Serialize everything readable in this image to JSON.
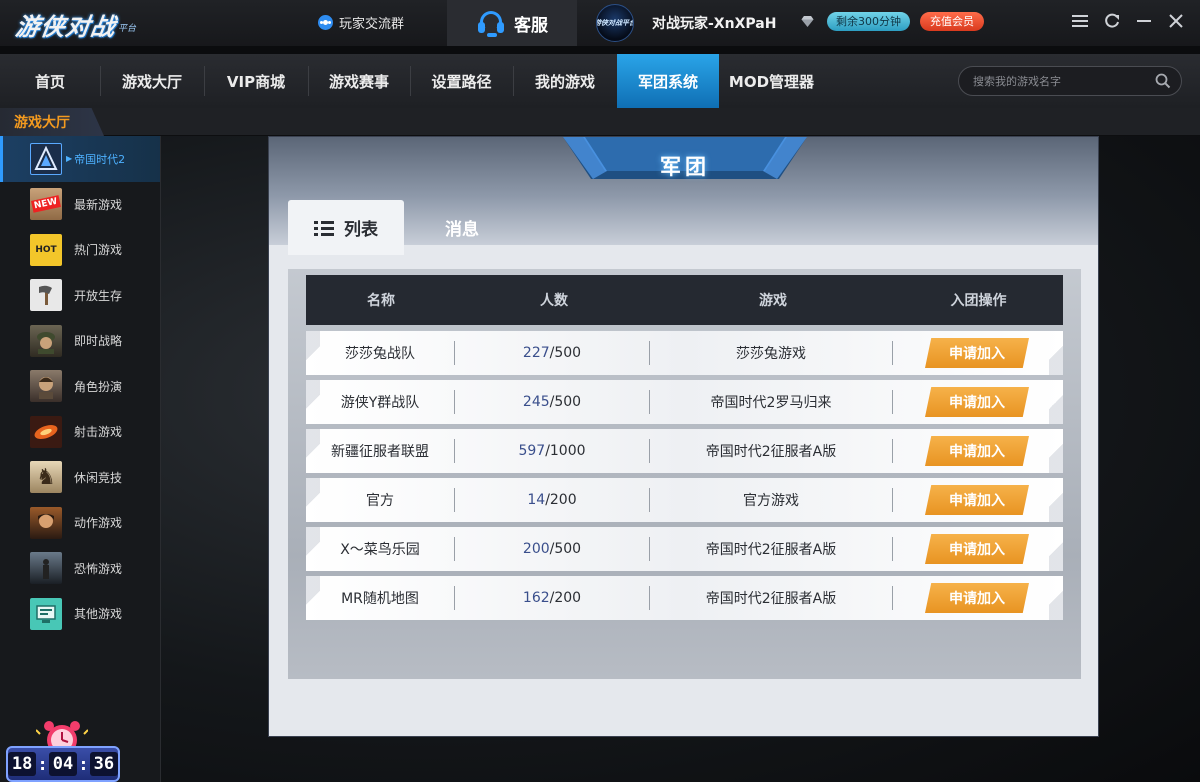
{
  "titlebar": {
    "logo_main": "游侠对战",
    "logo_sub": "平台",
    "group_link": "玩家交流群",
    "service": "客服",
    "avatar_text": "游侠对战平台",
    "username": "对战玩家-XnXPaH",
    "time_badge": "剩余300分钟",
    "vip_badge": "充值会员"
  },
  "nav": {
    "items": [
      "首页",
      "游戏大厅",
      "VIP商城",
      "游戏赛事",
      "设置路径",
      "我的游戏",
      "军团系统",
      "MOD管理器"
    ],
    "active_index": 6,
    "search_placeholder": "搜索我的游戏名字"
  },
  "breadcrumb": "游戏大厅",
  "sidebar": {
    "items": [
      {
        "label": "帝国时代2",
        "icon": "aoe2-icon",
        "active": true
      },
      {
        "label": "最新游戏",
        "icon": "new-icon",
        "icon_text": "NEW"
      },
      {
        "label": "热门游戏",
        "icon": "hot-icon",
        "icon_text": "HOT"
      },
      {
        "label": "开放生存",
        "icon": "axe-icon"
      },
      {
        "label": "即时战略",
        "icon": "soldier-icon"
      },
      {
        "label": "角色扮演",
        "icon": "character-icon"
      },
      {
        "label": "射击游戏",
        "icon": "shooter-icon"
      },
      {
        "label": "休闲竞技",
        "icon": "chess-knight-icon"
      },
      {
        "label": "动作游戏",
        "icon": "action-icon"
      },
      {
        "label": "恐怖游戏",
        "icon": "horror-icon"
      },
      {
        "label": "其他游戏",
        "icon": "other-icon"
      }
    ]
  },
  "panel": {
    "title": "军团",
    "tabs": [
      "列表",
      "消息"
    ],
    "active_tab": 0,
    "columns": [
      "名称",
      "人数",
      "游戏",
      "入团操作"
    ],
    "rows": [
      {
        "name": "莎莎兔战队",
        "members": "227",
        "capacity": "/500",
        "game": "莎莎兔游戏",
        "action": "申请加入"
      },
      {
        "name": "游侠Y群战队",
        "members": "245",
        "capacity": "/500",
        "game": "帝国时代2罗马归来",
        "action": "申请加入"
      },
      {
        "name": "新疆征服者联盟",
        "members": "597",
        "capacity": "/1000",
        "game": "帝国时代2征服者A版",
        "action": "申请加入"
      },
      {
        "name": "官方",
        "members": "14",
        "capacity": "/200",
        "game": "官方游戏",
        "action": "申请加入"
      },
      {
        "name": "X～菜鸟乐园",
        "members": "200",
        "capacity": "/500",
        "game": "帝国时代2征服者A版",
        "action": "申请加入"
      },
      {
        "name": "MR随机地图",
        "members": "162",
        "capacity": "/200",
        "game": "帝国时代2征服者A版",
        "action": "申请加入"
      }
    ]
  },
  "clock": {
    "h": "18",
    "m": "04",
    "s": "36"
  },
  "colors": {
    "accent": "#1f8ee0",
    "brand_orange": "#f39a1f",
    "join_button": "#f0a235",
    "vip_red": "#e34a2c"
  }
}
